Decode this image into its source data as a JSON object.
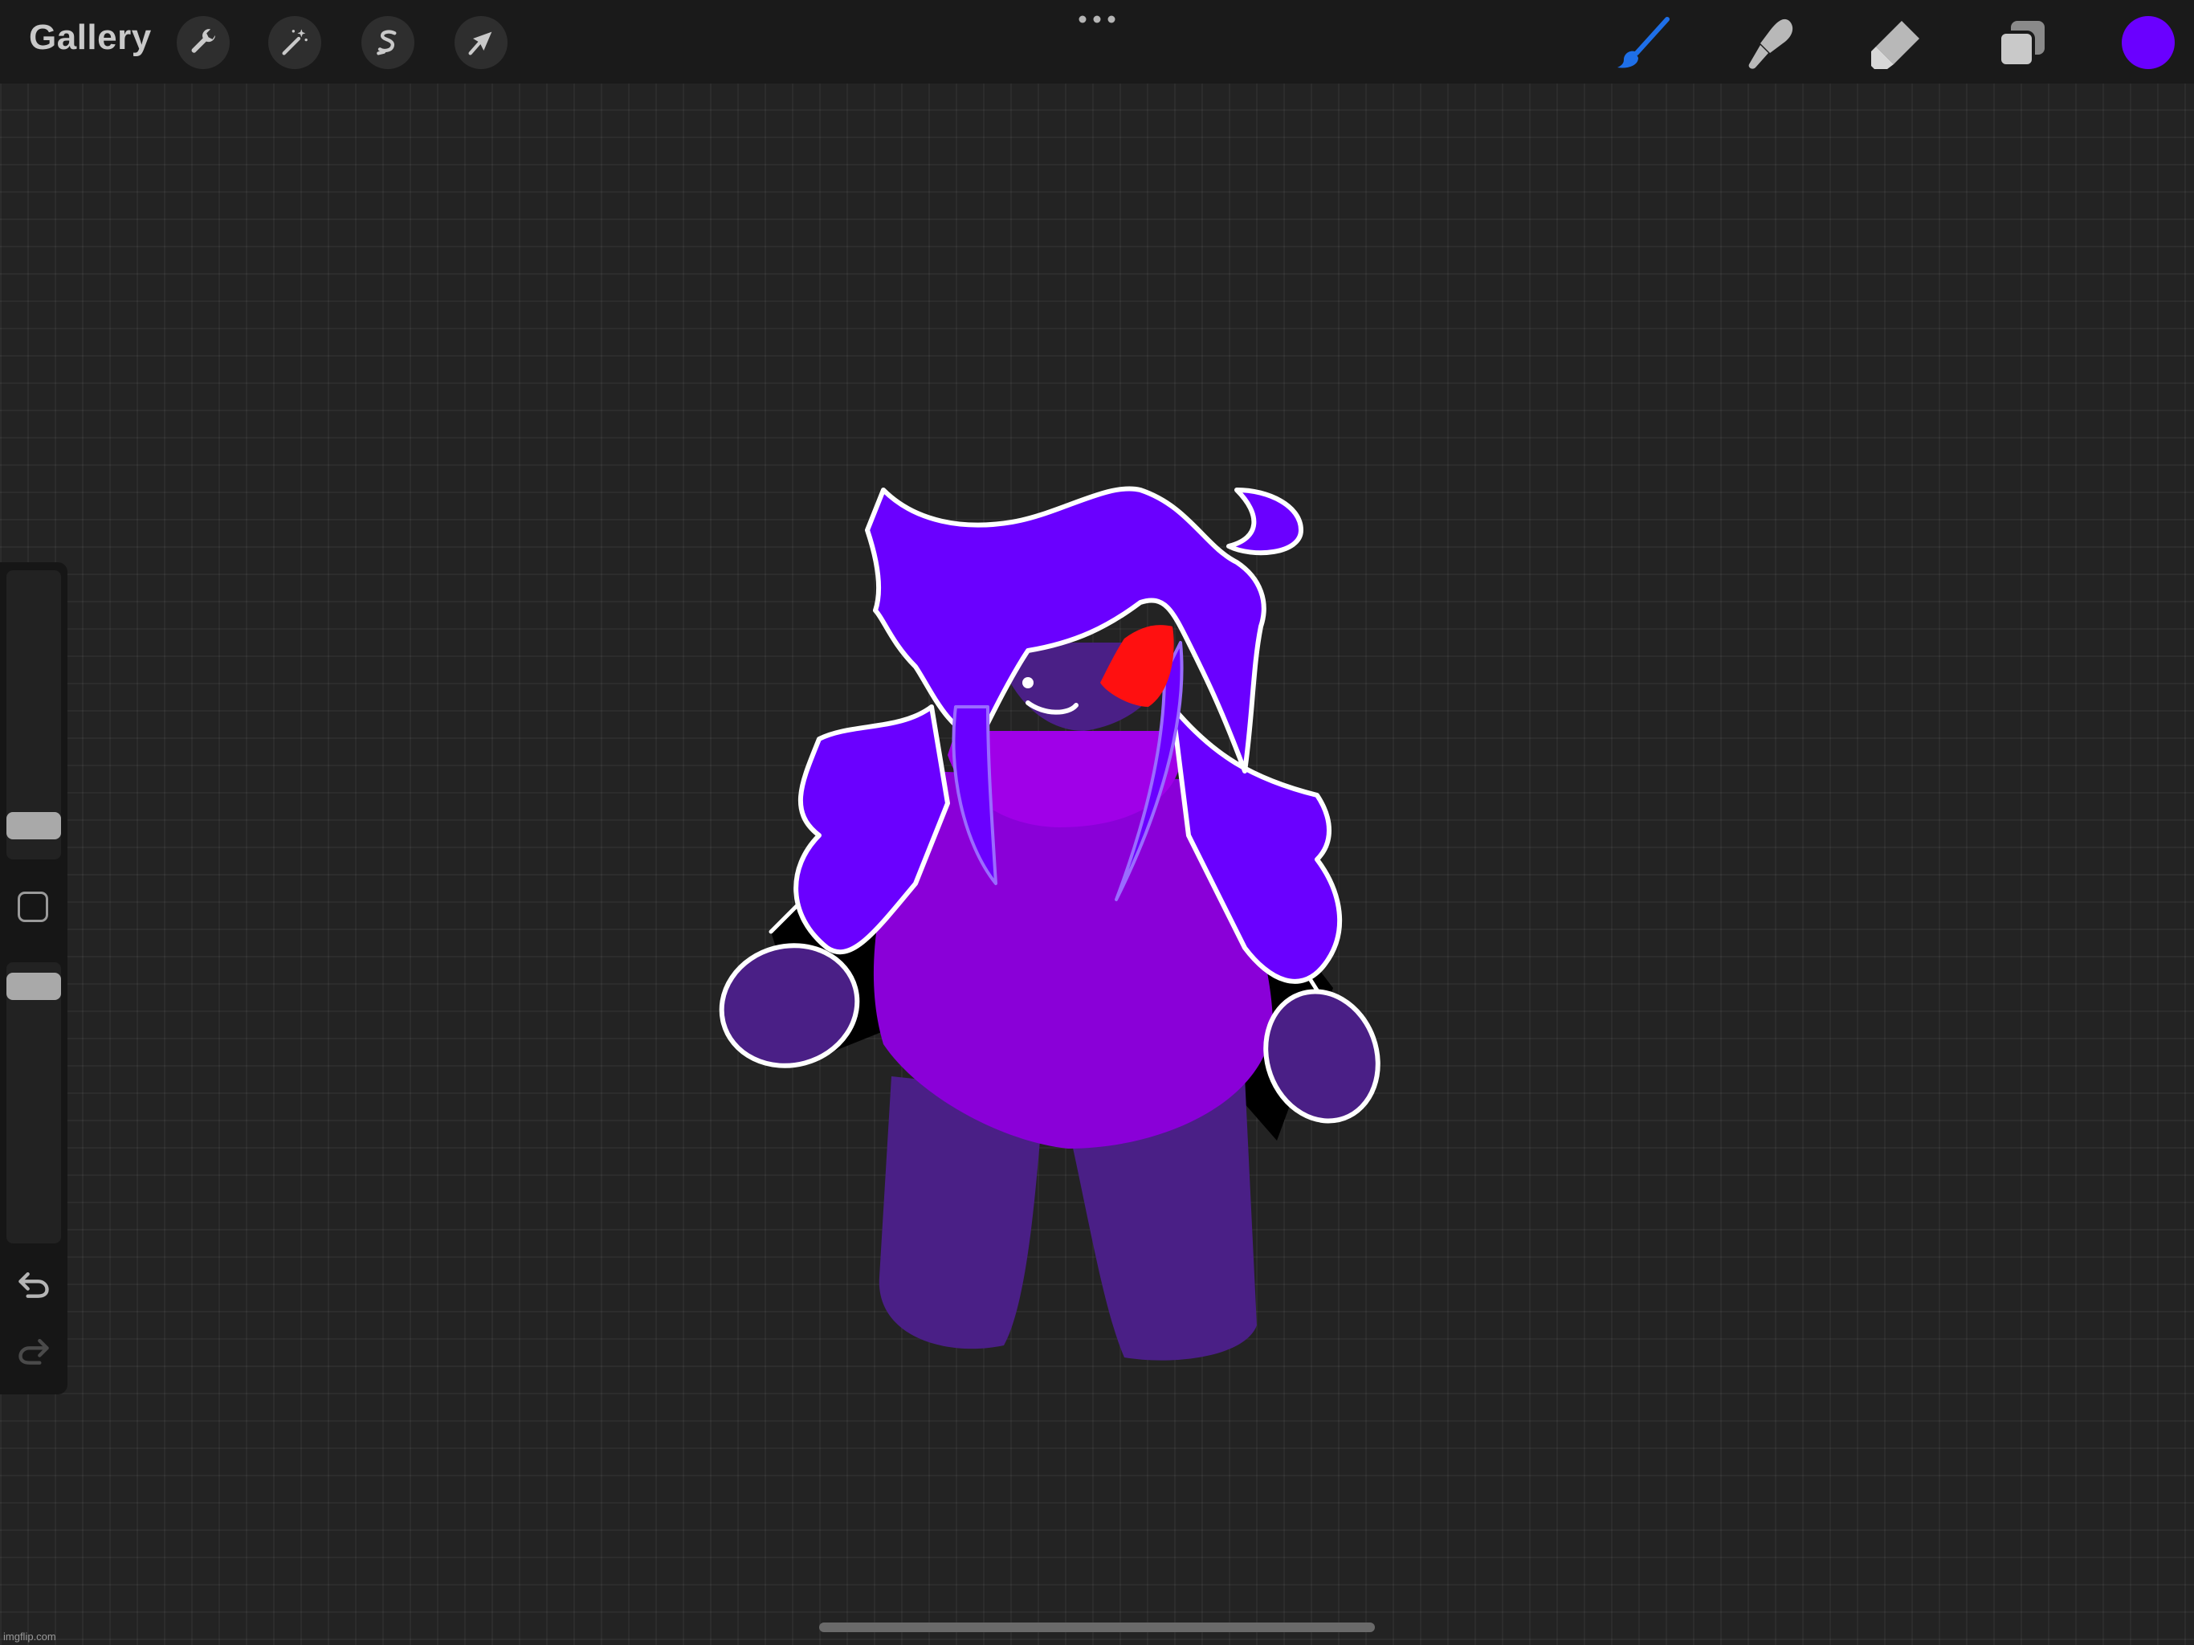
{
  "topbar": {
    "gallery_label": "Gallery",
    "left_tools": [
      {
        "name": "actions",
        "icon": "wrench-icon"
      },
      {
        "name": "adjustments",
        "icon": "magic-wand-icon"
      },
      {
        "name": "selection",
        "icon": "selection-s-icon"
      },
      {
        "name": "transform",
        "icon": "arrow-cursor-icon"
      }
    ],
    "more_icon": "more-dots-icon",
    "right_tools": [
      {
        "name": "brush",
        "icon": "brush-icon",
        "active": true
      },
      {
        "name": "smudge",
        "icon": "smudge-icon",
        "active": false
      },
      {
        "name": "eraser",
        "icon": "eraser-icon",
        "active": false
      },
      {
        "name": "layers",
        "icon": "layers-icon",
        "active": false
      }
    ],
    "current_color": "#6A00FF"
  },
  "sidebar": {
    "brush_size_icon": "brush-size-slider",
    "opacity_icon": "opacity-slider",
    "modify_icon": "modify-square-icon",
    "undo_icon": "undo-icon",
    "redo_icon": "redo-icon"
  },
  "colors": {
    "hair": "#6A00FF",
    "sweater": "#8A00D8",
    "sweater_collar": "#A000E8",
    "body": "#4A1F86",
    "eye": "#FF1010",
    "outline": "#FFFFFF",
    "arm_shadow": "#000000",
    "accent_blue": "#1E6FE8"
  },
  "watermark": "imgflip.com"
}
